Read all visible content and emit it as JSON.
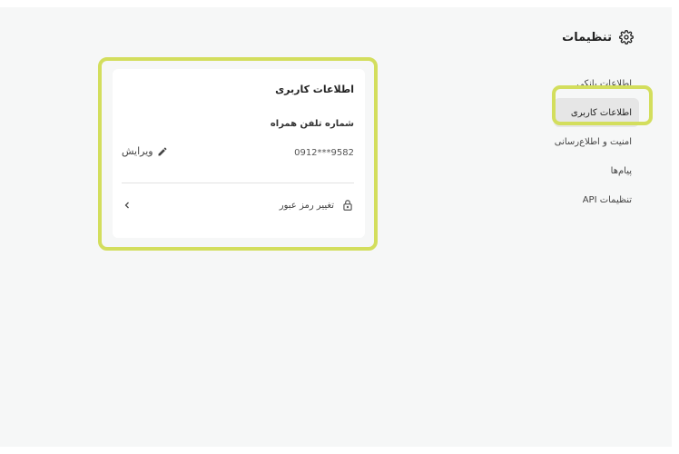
{
  "sidebar": {
    "title": "تنظیمات",
    "header_icon": "gear-icon",
    "items": [
      {
        "label": "اطلاعات بانکی",
        "active": false
      },
      {
        "label": "اطلاعات کاربری",
        "active": true
      },
      {
        "label": "امنیت و اطلاع‌رسانی",
        "active": false
      },
      {
        "label": "پیام‌ها",
        "active": false
      },
      {
        "label": "تنظیمات API",
        "active": false
      }
    ]
  },
  "card": {
    "title": "اطلاعات کاربری",
    "phone_label": "شماره تلفن همراه",
    "phone_value": "0912***9582",
    "edit_label": "ویرایش",
    "change_password_label": "تغییر رمز عبور"
  },
  "colors": {
    "highlight": "#d3de5d",
    "page_bg": "#f6f7f7",
    "active_item_bg": "#e6e6e6"
  }
}
